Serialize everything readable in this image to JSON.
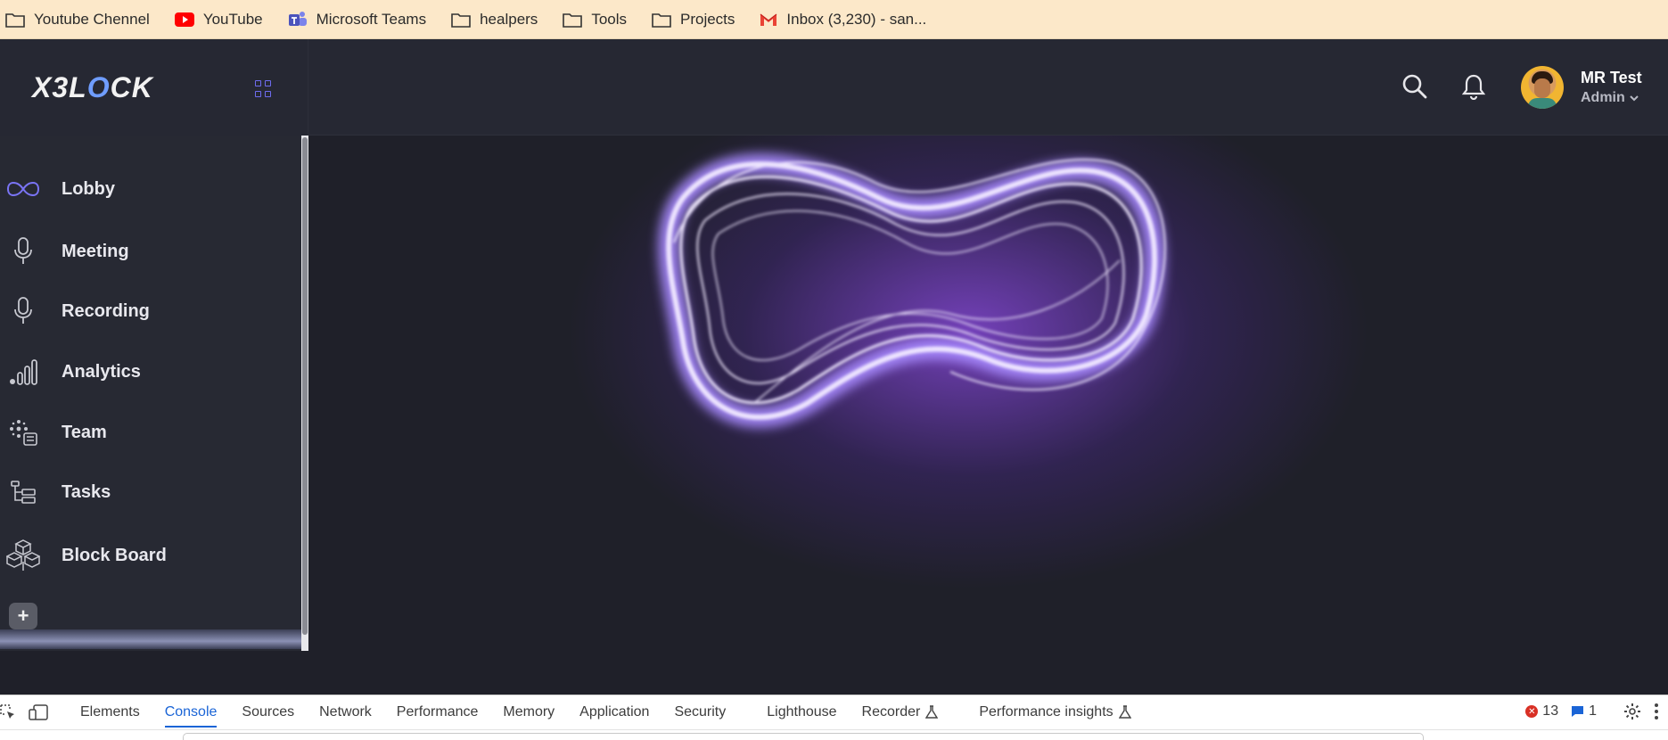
{
  "bookmarks": [
    {
      "label": "Youtube Chennel",
      "icon": "folder-icon"
    },
    {
      "label": "YouTube",
      "icon": "youtube-icon"
    },
    {
      "label": "Microsoft Teams",
      "icon": "teams-icon"
    },
    {
      "label": "healpers",
      "icon": "folder-icon"
    },
    {
      "label": "Tools",
      "icon": "folder-icon"
    },
    {
      "label": "Projects",
      "icon": "folder-icon"
    },
    {
      "label": "Inbox (3,230) - san...",
      "icon": "gmail-icon"
    }
  ],
  "header": {
    "logo": "X3L",
    "logo_mark": "O",
    "logo_tail": "CK",
    "user_name": "MR Test",
    "user_role": "Admin"
  },
  "sidebar": {
    "items": [
      {
        "label": "Lobby",
        "icon": "infinity-icon"
      },
      {
        "label": "Meeting",
        "icon": "microphone-icon"
      },
      {
        "label": "Recording",
        "icon": "microphone-icon"
      },
      {
        "label": "Analytics",
        "icon": "bar-chart-icon"
      },
      {
        "label": "Team",
        "icon": "team-icon"
      },
      {
        "label": "Tasks",
        "icon": "tree-icon"
      },
      {
        "label": "Block Board",
        "icon": "cubes-icon"
      }
    ],
    "add_label": "+"
  },
  "devtools": {
    "tabs": [
      "Elements",
      "Console",
      "Sources",
      "Network",
      "Performance",
      "Memory",
      "Application",
      "Security",
      "Lighthouse",
      "Recorder",
      "Performance insights"
    ],
    "active_tab": "Console",
    "error_count": "13",
    "message_count": "1"
  },
  "colors": {
    "accent": "#6e6cf0",
    "bookmarks_bg": "#fce8c9",
    "app_bg": "#1f2029",
    "glow": "#8a4be0",
    "devtools_active": "#1a64d6"
  }
}
